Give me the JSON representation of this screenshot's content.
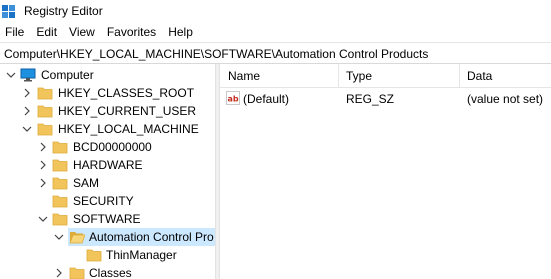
{
  "window": {
    "title": "Registry Editor"
  },
  "menu": {
    "items": [
      "File",
      "Edit",
      "View",
      "Favorites",
      "Help"
    ]
  },
  "address": {
    "path": "Computer\\HKEY_LOCAL_MACHINE\\SOFTWARE\\Automation Control Products"
  },
  "tree": {
    "nodes": [
      {
        "label": "Computer",
        "state": "expanded",
        "icon": "computer-icon"
      },
      {
        "label": "HKEY_CLASSES_ROOT",
        "state": "collapsed",
        "icon": "folder-icon"
      },
      {
        "label": "HKEY_CURRENT_USER",
        "state": "collapsed",
        "icon": "folder-icon"
      },
      {
        "label": "HKEY_LOCAL_MACHINE",
        "state": "expanded",
        "icon": "folder-icon"
      },
      {
        "label": "BCD00000000",
        "state": "collapsed",
        "icon": "folder-icon"
      },
      {
        "label": "HARDWARE",
        "state": "collapsed",
        "icon": "folder-icon"
      },
      {
        "label": "SAM",
        "state": "collapsed",
        "icon": "folder-icon"
      },
      {
        "label": "SECURITY",
        "state": "leaf",
        "icon": "folder-icon"
      },
      {
        "label": "SOFTWARE",
        "state": "expanded",
        "icon": "folder-icon"
      },
      {
        "label": "Automation Control Pro",
        "state": "expanded",
        "icon": "folder-open-icon",
        "selected": true
      },
      {
        "label": "ThinManager",
        "state": "leaf",
        "icon": "folder-icon"
      },
      {
        "label": "Classes",
        "state": "collapsed",
        "icon": "folder-icon"
      }
    ]
  },
  "list": {
    "columns": [
      "Name",
      "Type",
      "Data"
    ],
    "rows": [
      {
        "name": "(Default)",
        "type": "REG_SZ",
        "data": "(value not set)",
        "icon": "string-value-icon"
      }
    ]
  },
  "colors": {
    "selection": "#cce8ff",
    "folder": "#f2c55c",
    "folder_dark": "#dcab3a"
  }
}
